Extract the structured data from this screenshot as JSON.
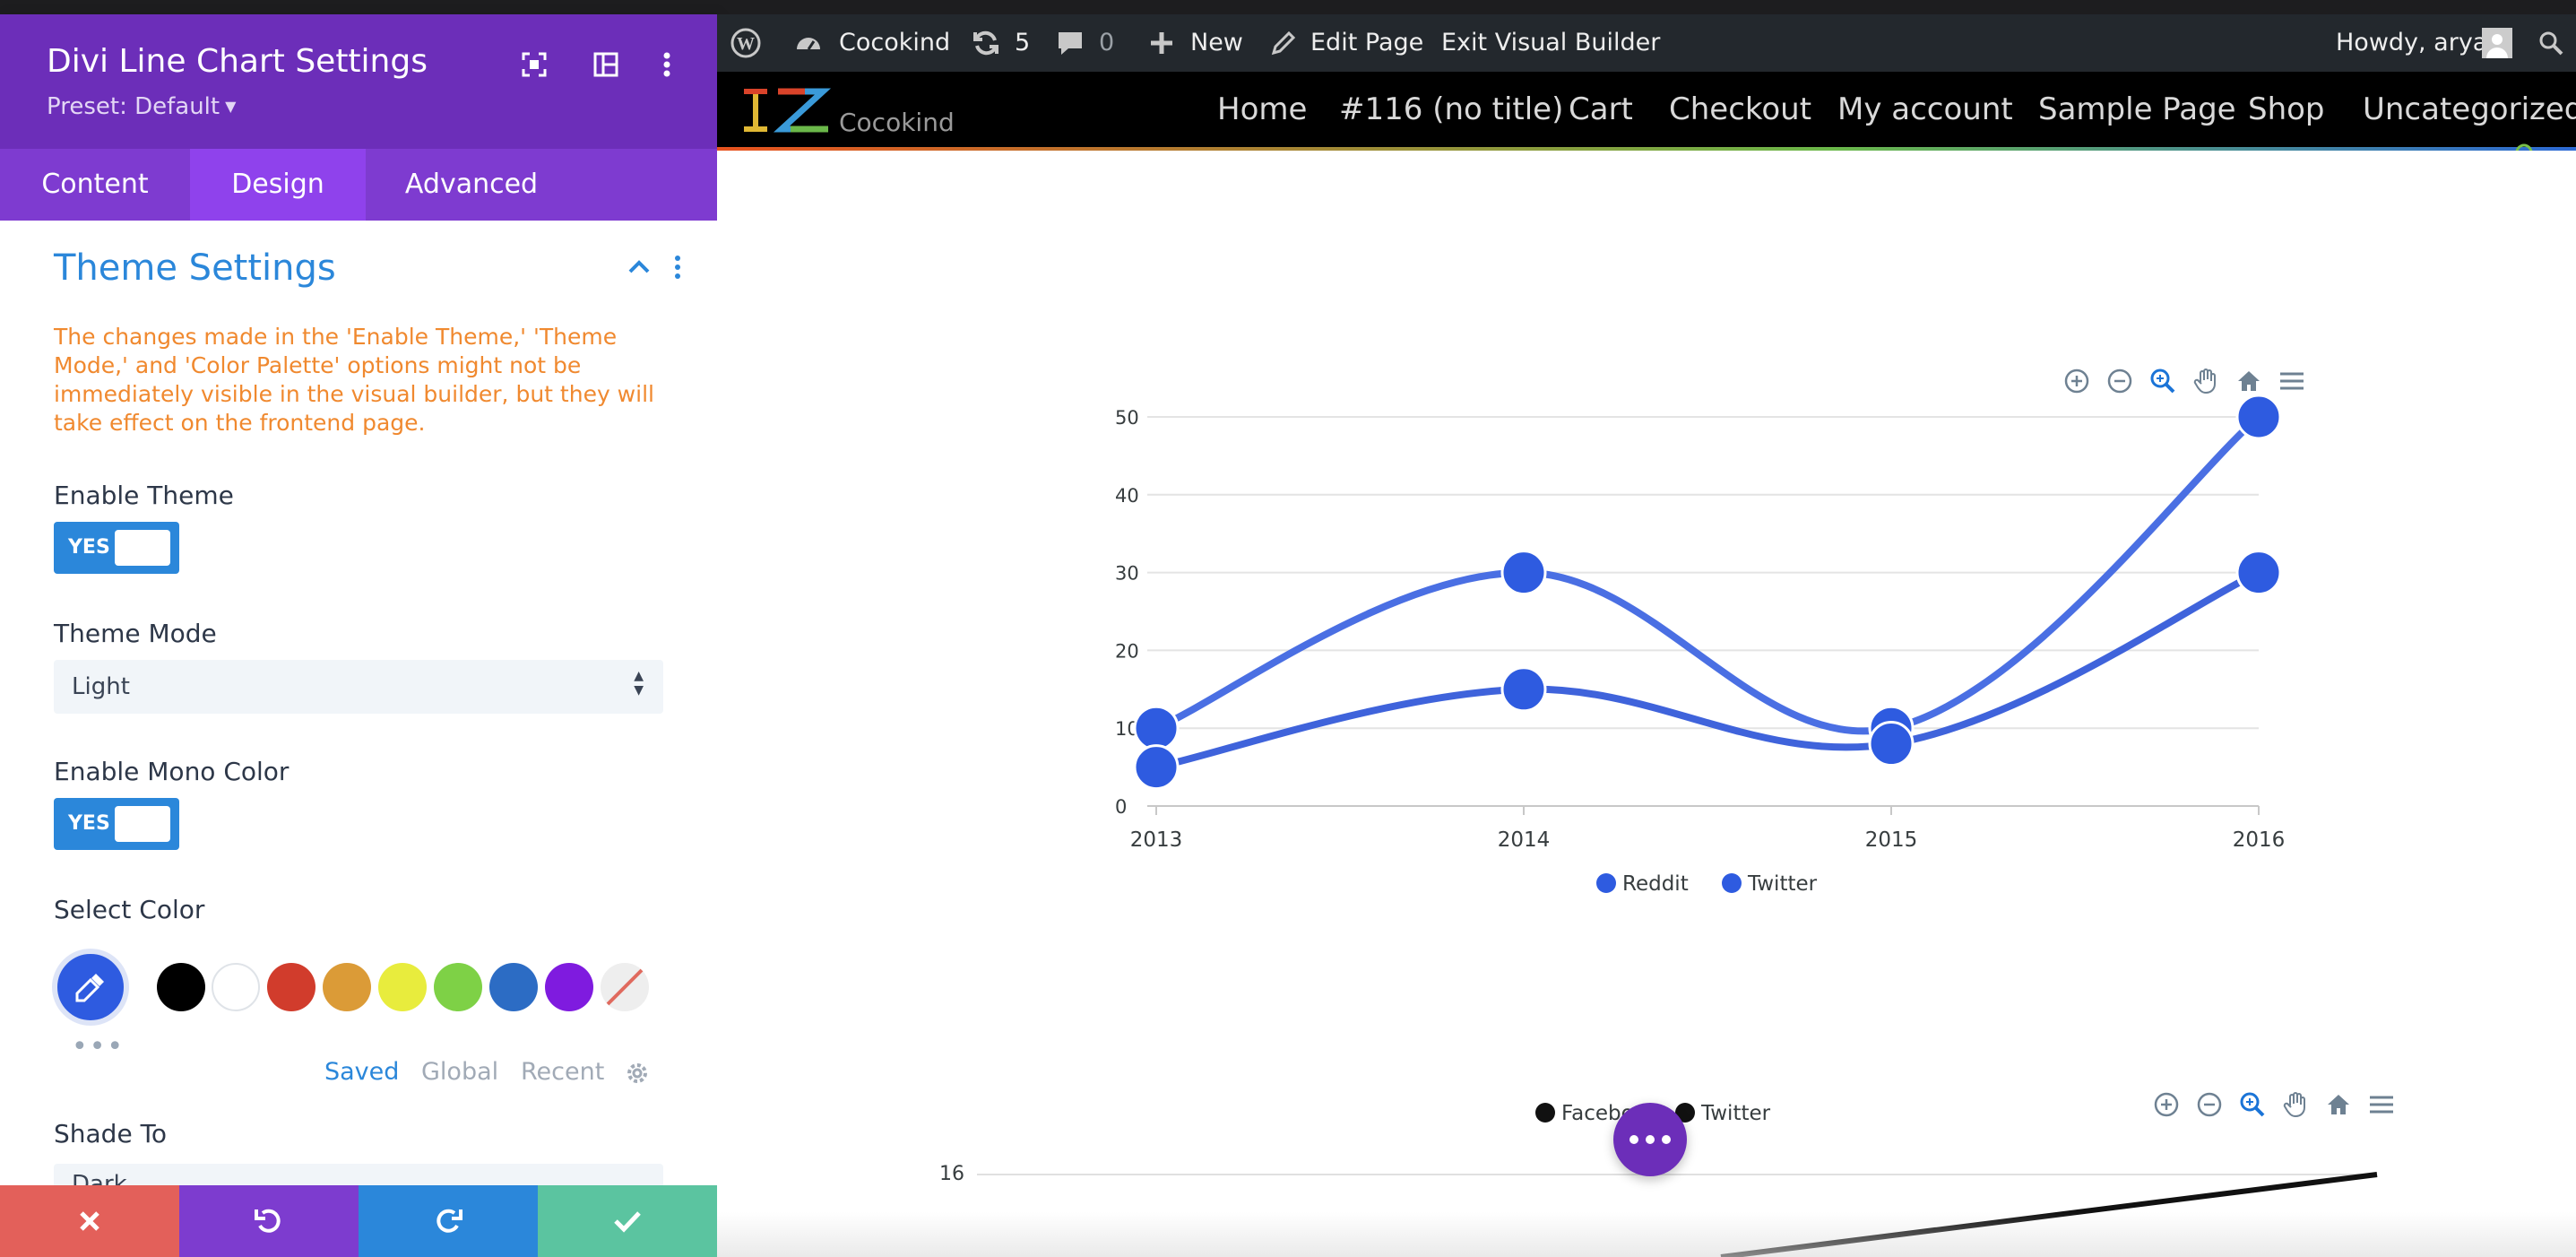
{
  "panel": {
    "title": "Divi Line Chart Settings",
    "preset": "Preset: Default",
    "tabs": [
      "Content",
      "Design",
      "Advanced"
    ],
    "active_tab": "Design",
    "section": {
      "title": "Theme Settings",
      "warning": "The changes made in the 'Enable Theme,' 'Theme Mode,' and 'Color Palette' options might not be immediately visible in the visual builder, but they will take effect on the frontend page."
    },
    "fields": {
      "enable_theme": {
        "label": "Enable Theme",
        "value": "YES"
      },
      "theme_mode": {
        "label": "Theme Mode",
        "value": "Light"
      },
      "enable_mono_color": {
        "label": "Enable Mono Color",
        "value": "YES"
      },
      "select_color": {
        "label": "Select Color"
      },
      "shade_to": {
        "label": "Shade To",
        "value": "Dark"
      }
    },
    "swatches": [
      "#000000",
      "#ffffff",
      "#d13c2c",
      "#db9b37",
      "#e8ec3d",
      "#7ed146",
      "#2c6cc4",
      "#7f1bdf",
      "none"
    ],
    "palette_tabs": [
      "Saved",
      "Global",
      "Recent"
    ],
    "active_palette_tab": "Saved",
    "accent_color": "#6c2eb9",
    "footer_colors": {
      "cancel": "#e3605a",
      "undo": "#7d3ccf",
      "redo": "#2b87da",
      "save": "#5bc4a0"
    }
  },
  "adminbar": {
    "site": "Cocokind",
    "updates": "5",
    "comments": "0",
    "new_label": "New",
    "edit_page": "Edit Page",
    "exit_builder": "Exit Visual Builder",
    "greeting": "Howdy, arya"
  },
  "site": {
    "name": "Cocokind",
    "menu": [
      "Home",
      "#116 (no title)",
      "Cart",
      "Checkout",
      "My account",
      "Sample Page",
      "Shop",
      "Uncategorized"
    ]
  },
  "chart_data": [
    {
      "type": "line",
      "categories": [
        "2013",
        "2014",
        "2015",
        "2016"
      ],
      "series": [
        {
          "name": "Reddit",
          "values": [
            10,
            30,
            10,
            50
          ]
        },
        {
          "name": "Twitter",
          "values": [
            5,
            15,
            8,
            30
          ]
        }
      ],
      "ylim": [
        0,
        50
      ],
      "yticks": [
        "0",
        "10",
        "20",
        "30",
        "40",
        "50"
      ],
      "curve": "smooth",
      "grid": true,
      "legend": "bottom-center",
      "color": "#2e5be0"
    },
    {
      "type": "line",
      "series": [
        {
          "name": "Facebook"
        },
        {
          "name": "Twitter"
        }
      ],
      "yticks_visible": [
        "16"
      ],
      "legend": "top-center",
      "color": "#111111",
      "partially_visible": true
    }
  ]
}
